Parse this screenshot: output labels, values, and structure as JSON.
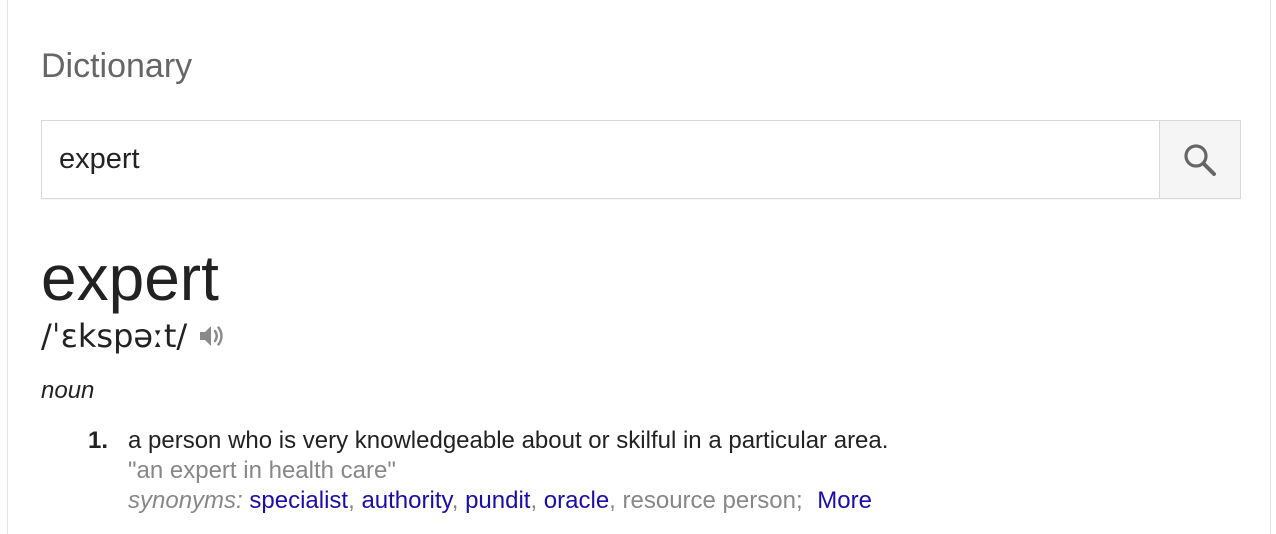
{
  "title": "Dictionary",
  "search": {
    "value": "expert",
    "button_icon": "search-icon"
  },
  "entry": {
    "headword": "expert",
    "pronunciation": "/ˈɛkspəːt/",
    "audio_icon": "speaker-icon",
    "part_of_speech": "noun",
    "senses": [
      {
        "number": "1.",
        "definition": "a person who is very knowledgeable about or skilful in a particular area.",
        "example": "\"an expert in health care\"",
        "synonyms_label": "synonyms:",
        "synonyms": [
          {
            "text": "specialist",
            "linked": true
          },
          {
            "text": "authority",
            "linked": true
          },
          {
            "text": "pundit",
            "linked": true
          },
          {
            "text": "oracle",
            "linked": true
          },
          {
            "text": "resource person",
            "linked": false
          }
        ],
        "more_label": "More"
      }
    ]
  },
  "colors": {
    "link": "#1a0dab",
    "muted_text": "#878787",
    "heading_text": "#666666",
    "body_text": "#222222",
    "border": "#d9d9d9",
    "button_bg": "#f5f5f5"
  }
}
